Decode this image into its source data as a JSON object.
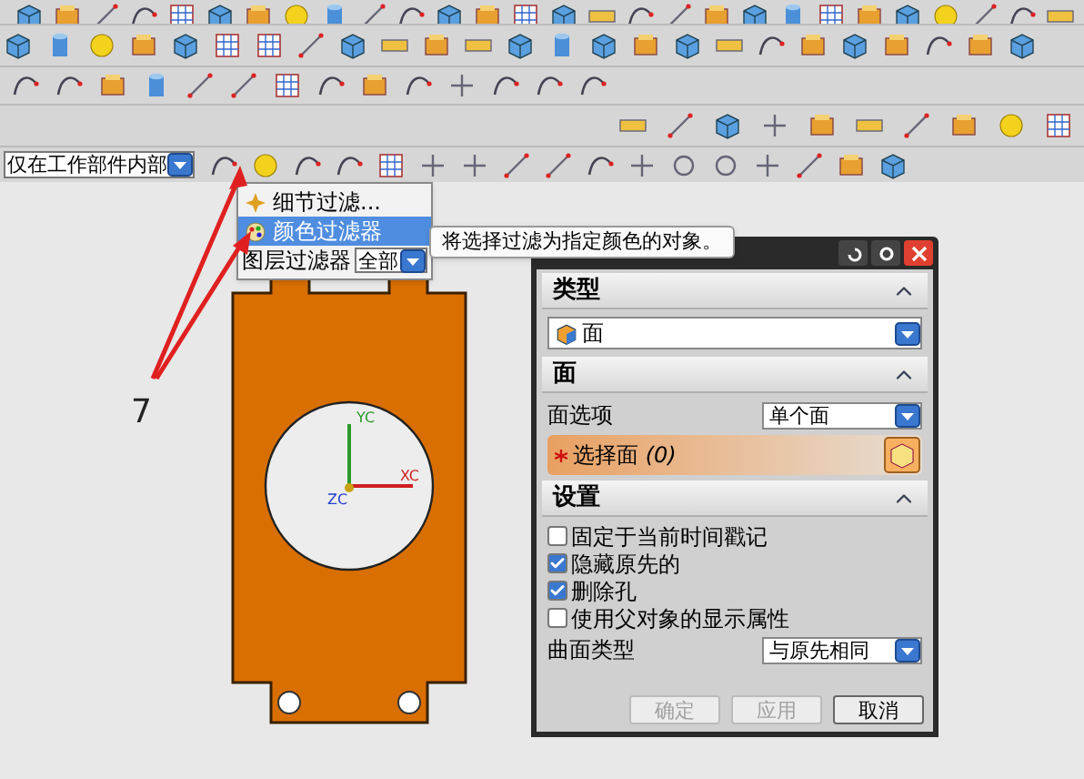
{
  "selection_bar": {
    "scope_dropdown": {
      "value": "仅在工作部件内部"
    }
  },
  "filter_menu": {
    "items": [
      {
        "kind": "item",
        "label": "细节过滤...",
        "selected": false
      },
      {
        "kind": "item",
        "label": "颜色过滤器",
        "selected": true
      },
      {
        "kind": "dropdown",
        "label": "图层过滤器",
        "value": "全部"
      }
    ]
  },
  "tooltip": "将选择过滤为指定颜色的对象。",
  "annotation": {
    "label": "7"
  },
  "viewport": {
    "axes": [
      {
        "kind": "y",
        "label": "YC"
      },
      {
        "kind": "z",
        "label": "ZC"
      },
      {
        "kind": "x",
        "label": "XC"
      }
    ]
  },
  "dialog": {
    "type_section": {
      "title": "类型",
      "expanded": true,
      "value": "面"
    },
    "face_section": {
      "title": "面",
      "expanded": true,
      "option_label": "面选项",
      "option_value": "单个面",
      "select_label": "选择面 *(0)*"
    },
    "settings_section": {
      "title": "设置",
      "expanded": true,
      "checkboxes": [
        {
          "label": "固定于当前时间戳记",
          "checked": false
        },
        {
          "label": "隐藏原先的",
          "checked": true
        },
        {
          "label": "删除孔",
          "checked": true
        },
        {
          "label": "使用父对象的显示属性",
          "checked": false
        }
      ],
      "surface_type_label": "曲面类型",
      "surface_type_value": "与原先相同"
    },
    "buttons": [
      {
        "label": "确定",
        "disabled": true
      },
      {
        "label": "应用",
        "disabled": true
      },
      {
        "label": "取消",
        "disabled": false
      }
    ]
  }
}
